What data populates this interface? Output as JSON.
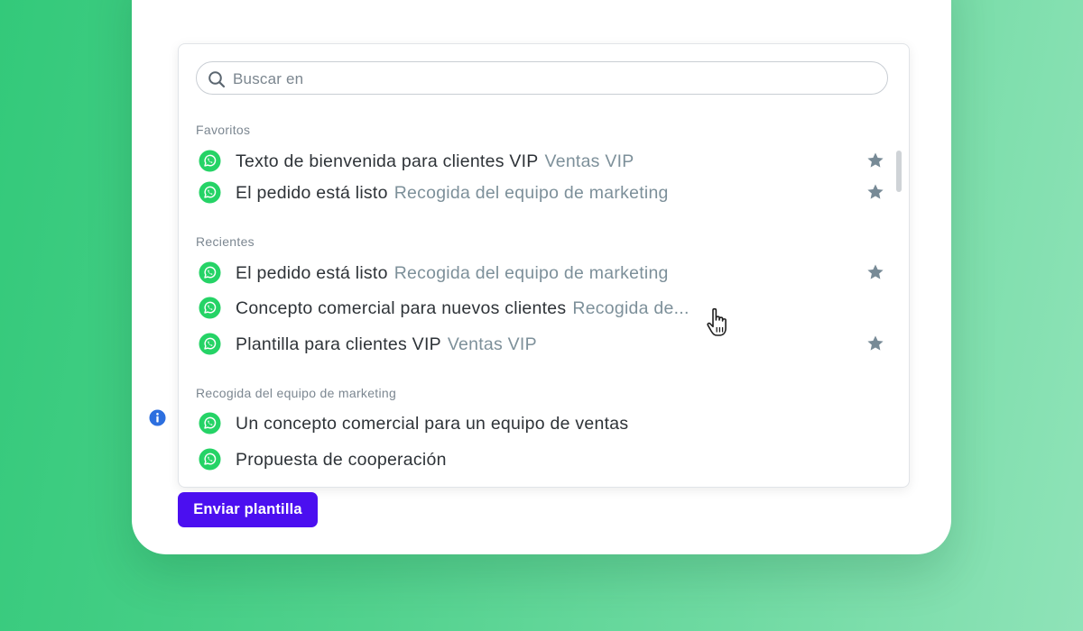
{
  "search": {
    "placeholder": "Buscar en",
    "value": ""
  },
  "sections": [
    {
      "title": "Favoritos",
      "items": [
        {
          "name": "Texto de bienvenida para clientes VIP",
          "collection": "Ventas VIP",
          "favorite": true
        },
        {
          "name": "El pedido está listo",
          "collection": "Recogida del equipo de marketing",
          "favorite": true
        }
      ]
    },
    {
      "title": "Recientes",
      "items": [
        {
          "name": "El pedido está listo",
          "collection": "Recogida del equipo de marketing",
          "favorite": true
        },
        {
          "name": "Concepto comercial para nuevos clientes",
          "collection": "Recogida de...",
          "favorite": false
        },
        {
          "name": "Plantilla para clientes VIP",
          "collection": "Ventas VIP",
          "favorite": true
        }
      ]
    },
    {
      "title": "Recogida del equipo de marketing",
      "items": [
        {
          "name": "Un concepto comercial para un equipo de ventas",
          "collection": "",
          "favorite": false
        },
        {
          "name": "Propuesta de cooperación",
          "collection": "",
          "favorite": false
        }
      ]
    }
  ],
  "send_button": {
    "label": "Enviar plantilla"
  },
  "icons": {
    "item": "whatsapp-icon",
    "favorite": "star-icon",
    "search": "search-icon",
    "info": "info-icon"
  },
  "colors": {
    "whatsapp_green": "#25d366",
    "star_gray": "#778a96",
    "primary_button": "#4b0ff0",
    "info_blue": "#2d6fdf",
    "background_green": "#44cc84"
  }
}
